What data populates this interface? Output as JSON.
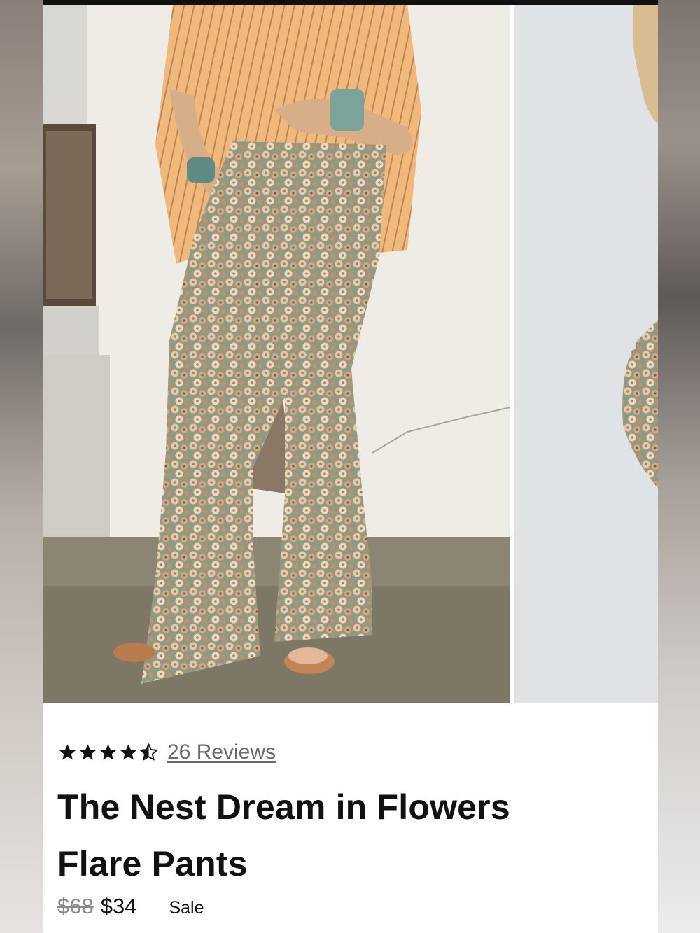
{
  "product": {
    "rating": 4.5,
    "rating_max": 5,
    "reviews_label": "26 Reviews",
    "title_line1": "The Nest Dream in Flowers",
    "title_line2": "Flare Pants",
    "price_original": "$68",
    "price_sale": "$34",
    "sale_label": "Sale"
  },
  "gallery": {
    "images": [
      {
        "name": "model-wearing-floral-flare-pants"
      },
      {
        "name": "floral-flare-pants-alternate-view"
      }
    ]
  },
  "colors": {
    "text": "#111111",
    "muted": "#8a8a8a",
    "link": "#6a6a6a",
    "background": "#ffffff"
  }
}
